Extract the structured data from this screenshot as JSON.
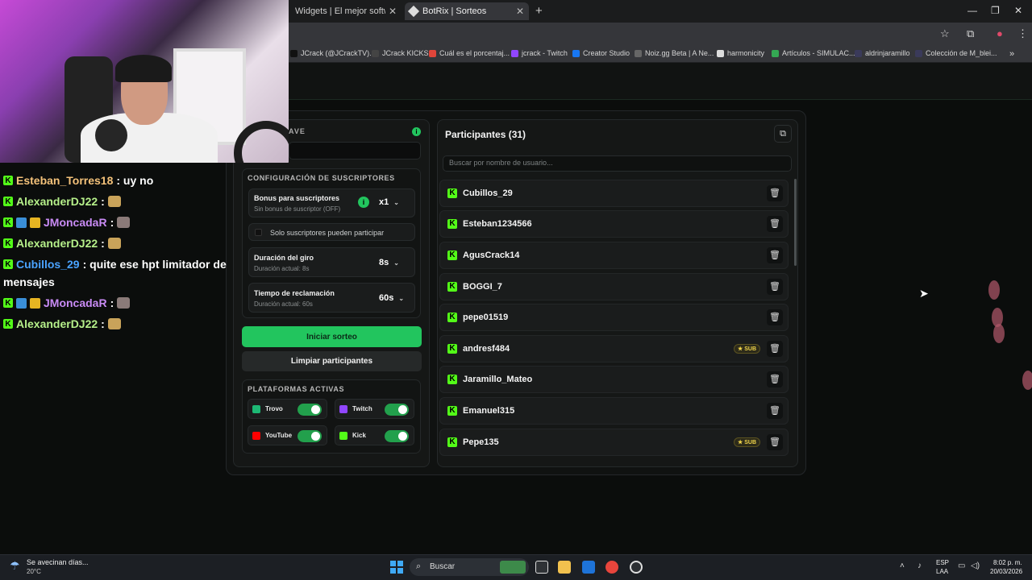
{
  "browser": {
    "tabs": [
      {
        "label": "Widgets | El mejor software pa"
      },
      {
        "label": "BotRix | Sorteos"
      }
    ],
    "new_tab": "+",
    "bookmarks": [
      {
        "label": "JCrack (@JCrackTV)...",
        "color": "#2b2b2b"
      },
      {
        "label": "JCrack KICKS",
        "color": "#444"
      },
      {
        "label": "Cuál es el porcentaj...",
        "color": "#e0453a"
      },
      {
        "label": "jcrack - Twitch",
        "color": "#9146ff"
      },
      {
        "label": "Creator Studio",
        "color": "#1877f2"
      },
      {
        "label": "Noiz.gg Beta | A Ne...",
        "color": "#666"
      },
      {
        "label": "harmonicity",
        "color": "#ddd"
      },
      {
        "label": "Artículos - SIMULAC...",
        "color": "#34a853"
      },
      {
        "label": "aldrinjaramillo",
        "color": "#3a3a5a"
      },
      {
        "label": "Colección de M_blei...",
        "color": "#3a3a5a"
      }
    ]
  },
  "chat": [
    {
      "user": "Esteban_Torres18",
      "color": "#f4c27a",
      "message": ": uy no"
    },
    {
      "user": "AlexanderDJ22",
      "color": "#b6f08a",
      "message": ":"
    },
    {
      "user": "JMoncadaR",
      "color": "#c98bf5",
      "message": ":"
    },
    {
      "user": "AlexanderDJ22",
      "color": "#b6f08a",
      "message": ":"
    },
    {
      "user": "Cubillos_29",
      "color": "#4aa3ff",
      "message": ": quite ese hpt limitador de"
    },
    {
      "user": "",
      "color": "#ffffff",
      "message": "mensajes"
    },
    {
      "user": "JMoncadaR",
      "color": "#c98bf5",
      "message": ":"
    },
    {
      "user": "AlexanderDJ22",
      "color": "#b6f08a",
      "message": ":"
    }
  ],
  "settings": {
    "clave_label": "AVE",
    "subs_title": "CONFIGURACIÓN DE SUSCRIPTORES",
    "bonus_title": "Bonus para suscriptores",
    "bonus_sub": "Sin bonus de suscriptor (OFF)",
    "bonus_value": "x1",
    "only_subs": "Solo suscriptores pueden participar",
    "spin_title": "Duración del giro",
    "spin_sub": "Duración actual: 8s",
    "spin_value": "8s",
    "claim_title": "Tiempo de reclamación",
    "claim_sub": "Duración actual: 60s",
    "claim_value": "60s",
    "start_button": "Iniciar sorteo",
    "clear_button": "Limpiar participantes",
    "platforms_title": "PLATAFORMAS ACTIVAS",
    "platforms": [
      {
        "name": "Trovo",
        "color": "#1db874",
        "on": true
      },
      {
        "name": "Twitch",
        "color": "#9146ff",
        "on": true
      },
      {
        "name": "YouTube",
        "color": "#ff0000",
        "on": true
      },
      {
        "name": "Kick",
        "color": "#53fc18",
        "on": true
      }
    ]
  },
  "participants": {
    "title": "Participantes (31)",
    "search_placeholder": "Buscar por nombre de usuario...",
    "sub_badge": "SUB",
    "list": [
      {
        "name": "Cubillos_29",
        "sub": false
      },
      {
        "name": "Esteban1234566",
        "sub": false
      },
      {
        "name": "AgusCrack14",
        "sub": false
      },
      {
        "name": "BOGGI_7",
        "sub": false
      },
      {
        "name": "pepe01519",
        "sub": false
      },
      {
        "name": "andresf484",
        "sub": true
      },
      {
        "name": "Jaramillo_Mateo",
        "sub": false
      },
      {
        "name": "Emanuel315",
        "sub": false
      },
      {
        "name": "Pepe135",
        "sub": true
      }
    ]
  },
  "taskbar": {
    "weather_text": "Se avecinan días...",
    "weather_temp": "20°C",
    "search": "Buscar",
    "lang1": "ESP",
    "lang2": "LAA",
    "time": "8:02 p. m.",
    "date": "20/03/2026"
  }
}
